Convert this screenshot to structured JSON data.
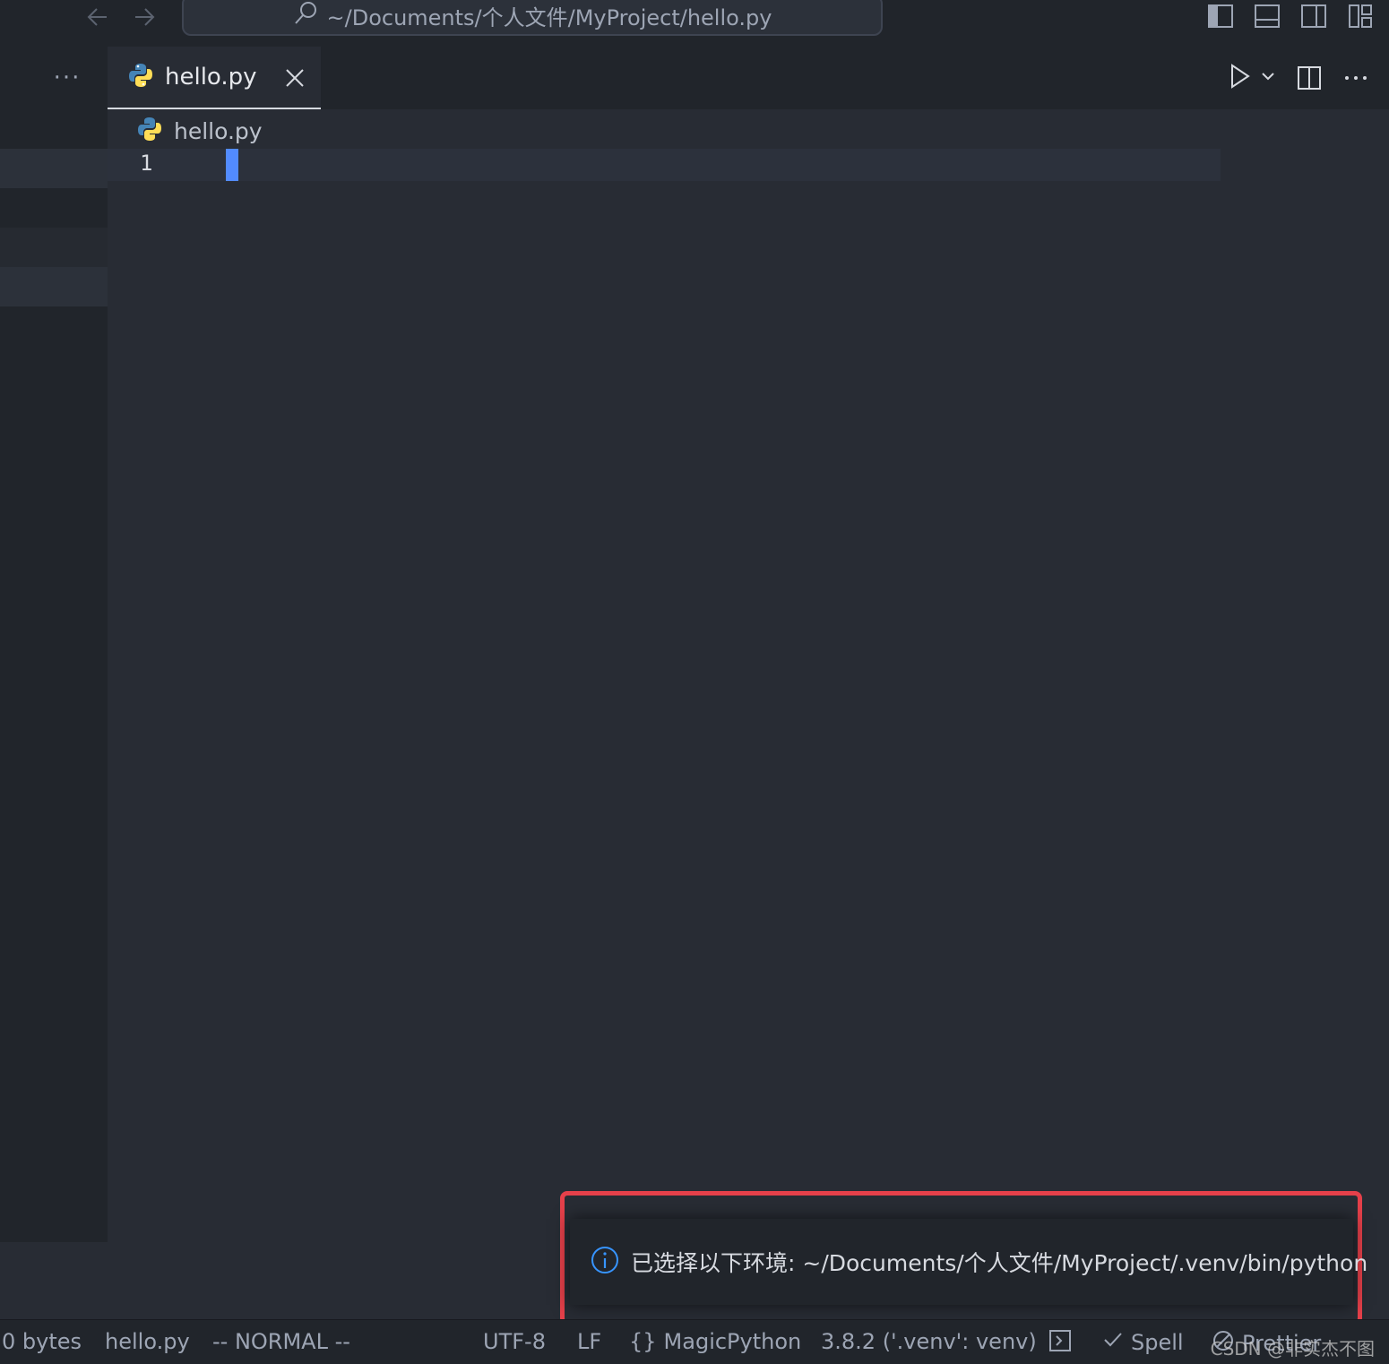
{
  "window": {
    "command_center_path": "~/Documents/个人文件/MyProject/hello.py"
  },
  "sidebar": {
    "more_label": "···"
  },
  "tabs": [
    {
      "label": "hello.py",
      "active": true,
      "icon": "python-icon"
    }
  ],
  "editor": {
    "breadcrumb": "hello.py",
    "line_numbers": [
      "1"
    ],
    "content": ""
  },
  "notification": {
    "type": "info",
    "icon": "info-icon",
    "message": "已选择以下环境: ~/Documents/个人文件/MyProject/.venv/bin/python"
  },
  "statusbar": {
    "file_size": "0 bytes",
    "file_name": "hello.py",
    "vim_mode": "-- NORMAL --",
    "encoding": "UTF-8",
    "line_ending": "LF",
    "language": "MagicPython",
    "interpreter": "3.8.2 ('.venv': venv)",
    "spell": "Spell",
    "prettier": "Prettier",
    "watermark": "CSDN @非实杰不图"
  },
  "colors": {
    "accent": "#528bff",
    "highlight_border": "#e5404a",
    "info": "#3794ff"
  }
}
